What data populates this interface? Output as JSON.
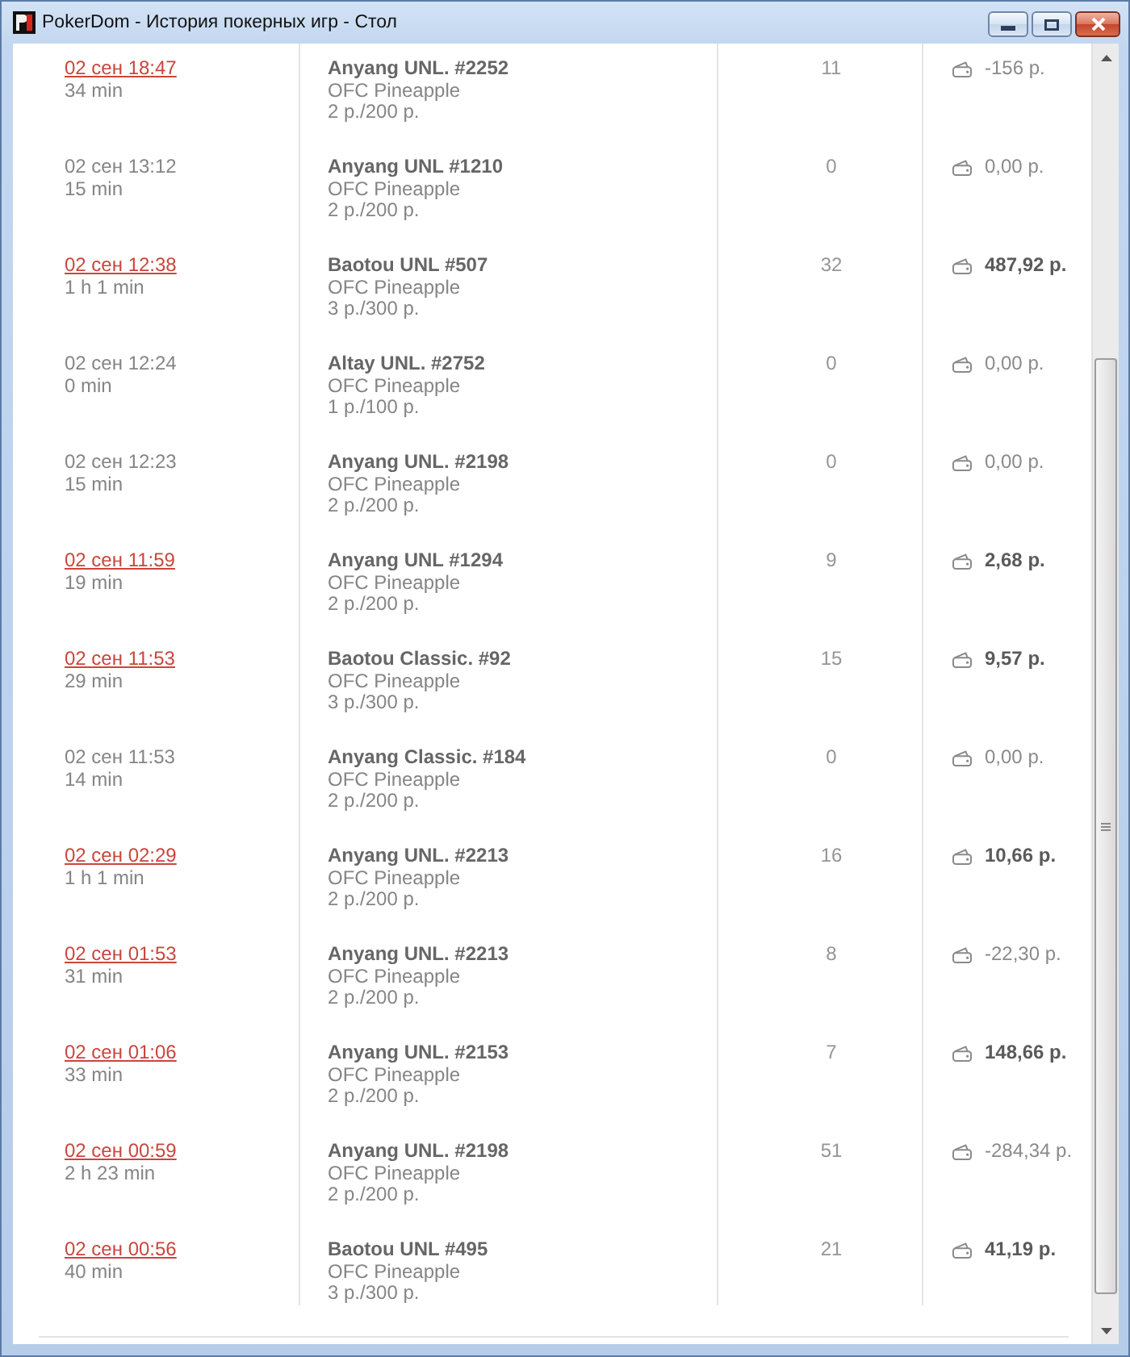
{
  "window": {
    "title": "PokerDom - История покерных игр - Стол"
  },
  "games": [
    {
      "date": "02 сен 18:47",
      "link": true,
      "duration": "34 min",
      "table": "Anyang UNL. #2252",
      "game": "OFC Pineapple",
      "stakes": "2 р./200 р.",
      "hands": "11",
      "amount": "-156 р.",
      "profit": false
    },
    {
      "date": "02 сен 13:12",
      "link": false,
      "duration": "15 min",
      "table": "Anyang UNL #1210",
      "game": "OFC Pineapple",
      "stakes": "2 р./200 р.",
      "hands": "0",
      "amount": "0,00 р.",
      "profit": false
    },
    {
      "date": "02 сен 12:38",
      "link": true,
      "duration": "1 h 1 min",
      "table": "Baotou UNL #507",
      "game": "OFC Pineapple",
      "stakes": "3 р./300 р.",
      "hands": "32",
      "amount": "487,92 р.",
      "profit": true
    },
    {
      "date": "02 сен 12:24",
      "link": false,
      "duration": "0 min",
      "table": "Altay UNL. #2752",
      "game": "OFC Pineapple",
      "stakes": "1 р./100 р.",
      "hands": "0",
      "amount": "0,00 р.",
      "profit": false
    },
    {
      "date": "02 сен 12:23",
      "link": false,
      "duration": "15 min",
      "table": "Anyang UNL. #2198",
      "game": "OFC Pineapple",
      "stakes": "2 р./200 р.",
      "hands": "0",
      "amount": "0,00 р.",
      "profit": false
    },
    {
      "date": "02 сен 11:59",
      "link": true,
      "duration": "19 min",
      "table": "Anyang UNL #1294",
      "game": "OFC Pineapple",
      "stakes": "2 р./200 р.",
      "hands": "9",
      "amount": "2,68 р.",
      "profit": true
    },
    {
      "date": "02 сен 11:53",
      "link": true,
      "duration": "29 min",
      "table": "Baotou Classic. #92",
      "game": "OFC Pineapple",
      "stakes": "3 р./300 р.",
      "hands": "15",
      "amount": "9,57 р.",
      "profit": true
    },
    {
      "date": "02 сен 11:53",
      "link": false,
      "duration": "14 min",
      "table": "Anyang Classic. #184",
      "game": "OFC Pineapple",
      "stakes": "2 р./200 р.",
      "hands": "0",
      "amount": "0,00 р.",
      "profit": false
    },
    {
      "date": "02 сен 02:29",
      "link": true,
      "duration": "1 h 1 min",
      "table": "Anyang UNL. #2213",
      "game": "OFC Pineapple",
      "stakes": "2 р./200 р.",
      "hands": "16",
      "amount": "10,66 р.",
      "profit": true
    },
    {
      "date": "02 сен 01:53",
      "link": true,
      "duration": "31 min",
      "table": "Anyang UNL. #2213",
      "game": "OFC Pineapple",
      "stakes": "2 р./200 р.",
      "hands": "8",
      "amount": "-22,30 р.",
      "profit": false
    },
    {
      "date": "02 сен 01:06",
      "link": true,
      "duration": "33 min",
      "table": "Anyang UNL. #2153",
      "game": "OFC Pineapple",
      "stakes": "2 р./200 р.",
      "hands": "7",
      "amount": "148,66 р.",
      "profit": true
    },
    {
      "date": "02 сен 00:59",
      "link": true,
      "duration": "2 h 23 min",
      "table": "Anyang UNL. #2198",
      "game": "OFC Pineapple",
      "stakes": "2 р./200 р.",
      "hands": "51",
      "amount": "-284,34 р.",
      "profit": false
    },
    {
      "date": "02 сен 00:56",
      "link": true,
      "duration": "40 min",
      "table": "Baotou UNL #495",
      "game": "OFC Pineapple",
      "stakes": "3 р./300 р.",
      "hands": "21",
      "amount": "41,19 р.",
      "profit": true
    }
  ]
}
